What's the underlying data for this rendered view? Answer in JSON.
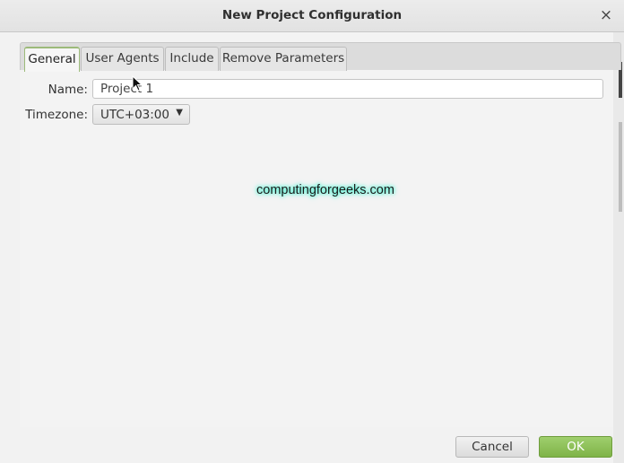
{
  "window": {
    "title": "New Project Configuration",
    "close_glyph": "×"
  },
  "tabs": [
    {
      "label": "General",
      "active": true
    },
    {
      "label": "User Agents",
      "active": false
    },
    {
      "label": "Include",
      "active": false
    },
    {
      "label": "Remove Parameters",
      "active": false
    }
  ],
  "form": {
    "name_label": "Name:",
    "name_value": "Project 1",
    "timezone_label": "Timezone:",
    "timezone_value": "UTC+03:00",
    "timezone_arrow": "▼"
  },
  "watermark": "computingforgeeks.com",
  "buttons": {
    "cancel": "Cancel",
    "ok": "OK"
  },
  "colors": {
    "ok_button": "#7fb348",
    "active_tab_accent": "#9cba7a",
    "watermark_glow": "#5ef3d6"
  }
}
